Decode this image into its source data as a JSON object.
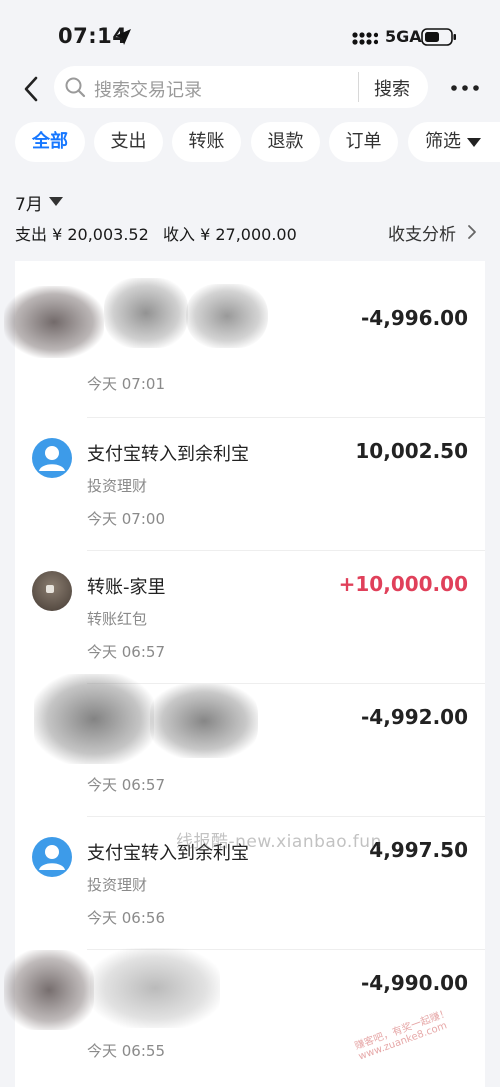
{
  "status_bar": {
    "time": "07:14",
    "network": "5GA"
  },
  "search": {
    "placeholder": "搜索交易记录",
    "button": "搜索"
  },
  "tabs": [
    {
      "label": "全部",
      "active": true
    },
    {
      "label": "支出",
      "active": false
    },
    {
      "label": "转账",
      "active": false
    },
    {
      "label": "退款",
      "active": false
    },
    {
      "label": "订单",
      "active": false
    },
    {
      "label": "筛选",
      "active": false
    }
  ],
  "summary": {
    "month": "7月",
    "expense": "支出 ¥ 20,003.52",
    "income": "收入 ¥ 27,000.00",
    "analysis": "收支分析"
  },
  "transactions": [
    {
      "title": "",
      "subtitle": "",
      "time": "今天 07:01",
      "amount": "-4,996.00",
      "type": "expense",
      "avatar": "redacted"
    },
    {
      "title": "支付宝转入到余利宝",
      "subtitle": "投资理财",
      "time": "今天 07:00",
      "amount": "10,002.50",
      "type": "neutral",
      "avatar": "person-icon"
    },
    {
      "title": "转账-家里",
      "subtitle": "转账红包",
      "time": "今天 06:57",
      "amount": "+10,000.00",
      "type": "income",
      "avatar": "photo"
    },
    {
      "title": "",
      "subtitle": "",
      "time": "今天 06:57",
      "amount": "-4,992.00",
      "type": "expense",
      "avatar": "redacted"
    },
    {
      "title": "支付宝转入到余利宝",
      "subtitle": "投资理财",
      "time": "今天 06:56",
      "amount": "4,997.50",
      "type": "neutral",
      "avatar": "person-icon"
    },
    {
      "title": "",
      "subtitle": "",
      "time": "今天 06:55",
      "amount": "-4,990.00",
      "type": "expense",
      "avatar": "redacted"
    }
  ],
  "watermark": "线报酷-new.xianbao.fun",
  "corner_watermark": "赚客吧，有奖一起赚！ www.zuanke8.com",
  "colors": {
    "accent": "#1677ff",
    "income": "#e0405a",
    "background": "#f3f4f7"
  }
}
